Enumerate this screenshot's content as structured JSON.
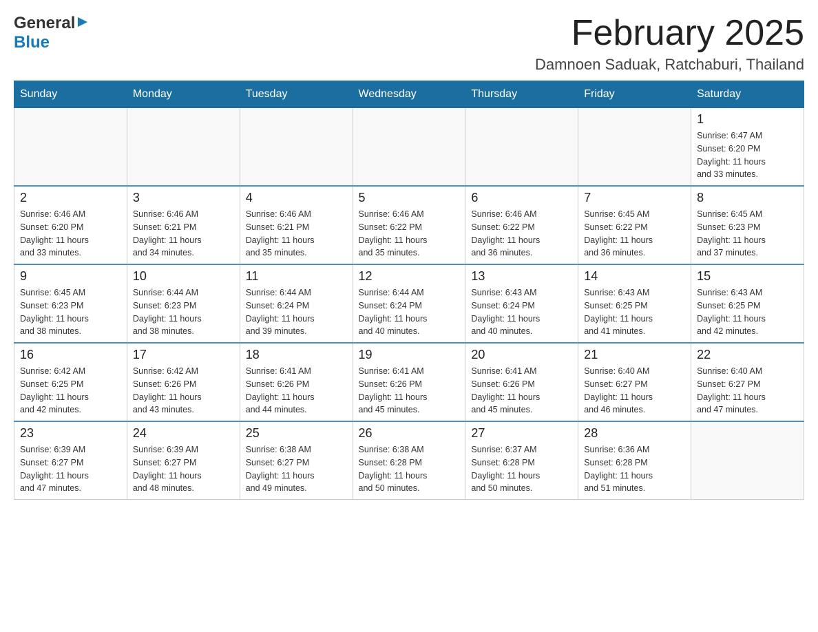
{
  "logo": {
    "general": "General",
    "blue": "Blue"
  },
  "header": {
    "month": "February 2025",
    "location": "Damnoen Saduak, Ratchaburi, Thailand"
  },
  "weekdays": [
    "Sunday",
    "Monday",
    "Tuesday",
    "Wednesday",
    "Thursday",
    "Friday",
    "Saturday"
  ],
  "weeks": [
    [
      {
        "day": "",
        "info": ""
      },
      {
        "day": "",
        "info": ""
      },
      {
        "day": "",
        "info": ""
      },
      {
        "day": "",
        "info": ""
      },
      {
        "day": "",
        "info": ""
      },
      {
        "day": "",
        "info": ""
      },
      {
        "day": "1",
        "info": "Sunrise: 6:47 AM\nSunset: 6:20 PM\nDaylight: 11 hours\nand 33 minutes."
      }
    ],
    [
      {
        "day": "2",
        "info": "Sunrise: 6:46 AM\nSunset: 6:20 PM\nDaylight: 11 hours\nand 33 minutes."
      },
      {
        "day": "3",
        "info": "Sunrise: 6:46 AM\nSunset: 6:21 PM\nDaylight: 11 hours\nand 34 minutes."
      },
      {
        "day": "4",
        "info": "Sunrise: 6:46 AM\nSunset: 6:21 PM\nDaylight: 11 hours\nand 35 minutes."
      },
      {
        "day": "5",
        "info": "Sunrise: 6:46 AM\nSunset: 6:22 PM\nDaylight: 11 hours\nand 35 minutes."
      },
      {
        "day": "6",
        "info": "Sunrise: 6:46 AM\nSunset: 6:22 PM\nDaylight: 11 hours\nand 36 minutes."
      },
      {
        "day": "7",
        "info": "Sunrise: 6:45 AM\nSunset: 6:22 PM\nDaylight: 11 hours\nand 36 minutes."
      },
      {
        "day": "8",
        "info": "Sunrise: 6:45 AM\nSunset: 6:23 PM\nDaylight: 11 hours\nand 37 minutes."
      }
    ],
    [
      {
        "day": "9",
        "info": "Sunrise: 6:45 AM\nSunset: 6:23 PM\nDaylight: 11 hours\nand 38 minutes."
      },
      {
        "day": "10",
        "info": "Sunrise: 6:44 AM\nSunset: 6:23 PM\nDaylight: 11 hours\nand 38 minutes."
      },
      {
        "day": "11",
        "info": "Sunrise: 6:44 AM\nSunset: 6:24 PM\nDaylight: 11 hours\nand 39 minutes."
      },
      {
        "day": "12",
        "info": "Sunrise: 6:44 AM\nSunset: 6:24 PM\nDaylight: 11 hours\nand 40 minutes."
      },
      {
        "day": "13",
        "info": "Sunrise: 6:43 AM\nSunset: 6:24 PM\nDaylight: 11 hours\nand 40 minutes."
      },
      {
        "day": "14",
        "info": "Sunrise: 6:43 AM\nSunset: 6:25 PM\nDaylight: 11 hours\nand 41 minutes."
      },
      {
        "day": "15",
        "info": "Sunrise: 6:43 AM\nSunset: 6:25 PM\nDaylight: 11 hours\nand 42 minutes."
      }
    ],
    [
      {
        "day": "16",
        "info": "Sunrise: 6:42 AM\nSunset: 6:25 PM\nDaylight: 11 hours\nand 42 minutes."
      },
      {
        "day": "17",
        "info": "Sunrise: 6:42 AM\nSunset: 6:26 PM\nDaylight: 11 hours\nand 43 minutes."
      },
      {
        "day": "18",
        "info": "Sunrise: 6:41 AM\nSunset: 6:26 PM\nDaylight: 11 hours\nand 44 minutes."
      },
      {
        "day": "19",
        "info": "Sunrise: 6:41 AM\nSunset: 6:26 PM\nDaylight: 11 hours\nand 45 minutes."
      },
      {
        "day": "20",
        "info": "Sunrise: 6:41 AM\nSunset: 6:26 PM\nDaylight: 11 hours\nand 45 minutes."
      },
      {
        "day": "21",
        "info": "Sunrise: 6:40 AM\nSunset: 6:27 PM\nDaylight: 11 hours\nand 46 minutes."
      },
      {
        "day": "22",
        "info": "Sunrise: 6:40 AM\nSunset: 6:27 PM\nDaylight: 11 hours\nand 47 minutes."
      }
    ],
    [
      {
        "day": "23",
        "info": "Sunrise: 6:39 AM\nSunset: 6:27 PM\nDaylight: 11 hours\nand 47 minutes."
      },
      {
        "day": "24",
        "info": "Sunrise: 6:39 AM\nSunset: 6:27 PM\nDaylight: 11 hours\nand 48 minutes."
      },
      {
        "day": "25",
        "info": "Sunrise: 6:38 AM\nSunset: 6:27 PM\nDaylight: 11 hours\nand 49 minutes."
      },
      {
        "day": "26",
        "info": "Sunrise: 6:38 AM\nSunset: 6:28 PM\nDaylight: 11 hours\nand 50 minutes."
      },
      {
        "day": "27",
        "info": "Sunrise: 6:37 AM\nSunset: 6:28 PM\nDaylight: 11 hours\nand 50 minutes."
      },
      {
        "day": "28",
        "info": "Sunrise: 6:36 AM\nSunset: 6:28 PM\nDaylight: 11 hours\nand 51 minutes."
      },
      {
        "day": "",
        "info": ""
      }
    ]
  ]
}
